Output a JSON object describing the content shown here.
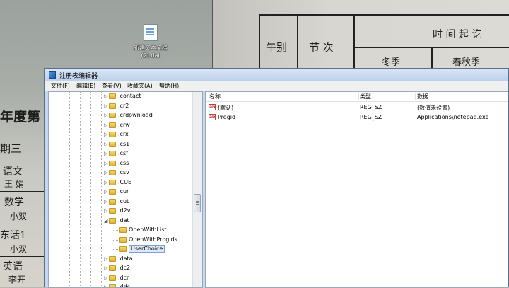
{
  "desktop": {
    "icon_label_1": "新建文本文档",
    "icon_label_2": "(2).dat"
  },
  "wallpaper": {
    "col1": "午别",
    "col2": "节 次",
    "header": "时 间 起 讫",
    "winter": "冬季",
    "spring_autumn": "春秋季",
    "year_title": "年度第",
    "week": "期三",
    "sub1": "语文",
    "sub1_t": "王 娟",
    "sub2": "数学",
    "sub2_t": "小双",
    "sub3": "东活1",
    "sub3_t": "小双",
    "sub4": "英语",
    "sub4_t": "李开"
  },
  "window": {
    "title": "注册表编辑器"
  },
  "menu": [
    "文件(F)",
    "编辑(E)",
    "查看(V)",
    "收藏夹(A)",
    "帮助(H)"
  ],
  "tree": [
    {
      "name": ".contact",
      "exp": "▷"
    },
    {
      "name": ".cr2",
      "exp": "▷"
    },
    {
      "name": ".crdownload",
      "exp": "▷"
    },
    {
      "name": ".crw",
      "exp": "▷"
    },
    {
      "name": ".crx",
      "exp": "▷"
    },
    {
      "name": ".cs1",
      "exp": "▷"
    },
    {
      "name": ".csf",
      "exp": "▷"
    },
    {
      "name": ".css",
      "exp": "▷"
    },
    {
      "name": ".csv",
      "exp": "▷"
    },
    {
      "name": ".CUE",
      "exp": "▷"
    },
    {
      "name": ".cur",
      "exp": "▷"
    },
    {
      "name": ".cut",
      "exp": "▷"
    },
    {
      "name": ".d2v",
      "exp": "▷"
    },
    {
      "name": ".dat",
      "exp": "◢"
    },
    {
      "name": "OpenWithList",
      "exp": ""
    },
    {
      "name": "OpenWithProgids",
      "exp": ""
    },
    {
      "name": "UserChoice",
      "exp": ""
    },
    {
      "name": ".data",
      "exp": "▷"
    },
    {
      "name": ".dc2",
      "exp": "▷"
    },
    {
      "name": ".dcr",
      "exp": "▷"
    },
    {
      "name": ".dds",
      "exp": "▷"
    }
  ],
  "columns": {
    "name": "名称",
    "type": "类型",
    "data": "数据"
  },
  "values": [
    {
      "name": "(默认)",
      "type": "REG_SZ",
      "data": "(数值未设置)"
    },
    {
      "name": "Progid",
      "type": "REG_SZ",
      "data": "Applications\\notepad.exe"
    }
  ],
  "icon_glyphs": {
    "string_value": "ab"
  }
}
